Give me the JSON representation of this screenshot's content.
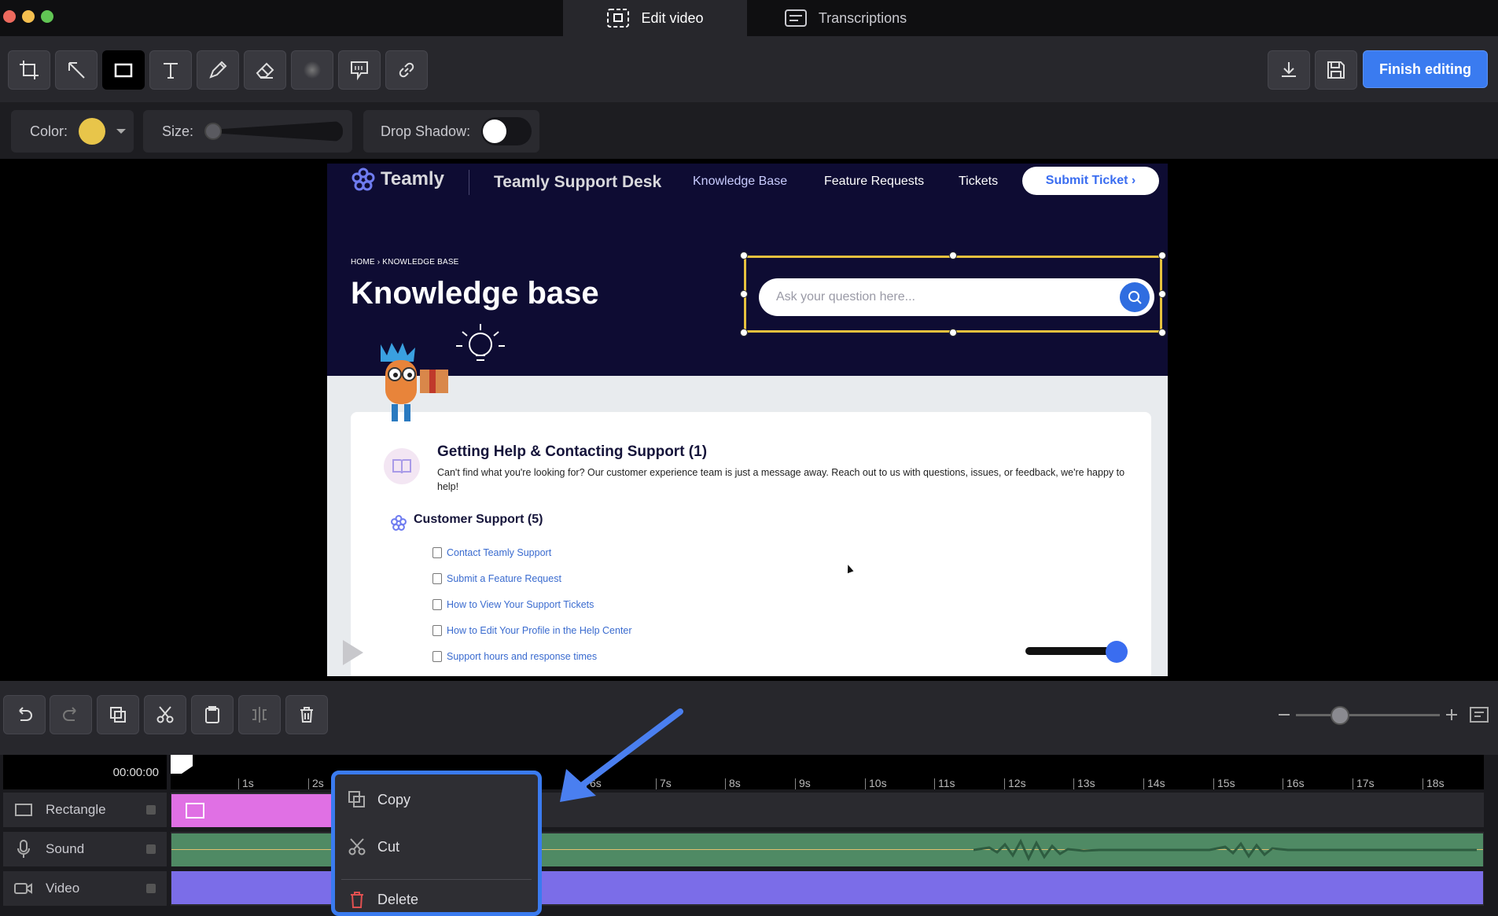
{
  "titlebar": {
    "tabs": [
      {
        "label": "Edit video",
        "active": true
      },
      {
        "label": "Transcriptions",
        "active": false
      }
    ]
  },
  "toolbar": {
    "tools": [
      "crop-icon",
      "arrow-icon",
      "rectangle-icon",
      "text-icon",
      "pencil-icon",
      "eraser-icon",
      "blur-icon",
      "callout-icon",
      "link-icon"
    ],
    "selected_tool": "rectangle-icon",
    "finish_label": "Finish editing"
  },
  "options": {
    "color_label": "Color:",
    "color_value": "#e8c54a",
    "size_label": "Size:",
    "size_level": 0,
    "shadow_label": "Drop Shadow:",
    "shadow_on": false
  },
  "canvas": {
    "brand": "Teamly",
    "desk_title": "Teamly Support Desk",
    "nav": [
      "Knowledge Base",
      "Feature Requests",
      "Tickets"
    ],
    "submit_ticket": "Submit Ticket ›",
    "breadcrumb": "HOME  ›  KNOWLEDGE BASE",
    "page_title": "Knowledge base",
    "search_placeholder": "Ask your question here...",
    "section_title": "Getting Help & Contacting Support (1)",
    "section_desc": "Can't find what you're looking for? Our customer experience team is just a message away. Reach out to us with questions, issues, or feedback, we're happy to help!",
    "subsection_title": "Customer Support (5)",
    "articles": [
      "Contact Teamly Support",
      "Submit a Feature Request",
      "How to View Your Support Tickets",
      "How to Edit Your Profile in the Help Center",
      "Support hours and response times"
    ]
  },
  "timeline": {
    "timecode": "00:00:00",
    "ticks": [
      "1s",
      "2s",
      "6s",
      "7s",
      "8s",
      "9s",
      "10s",
      "11s",
      "12s",
      "13s",
      "14s",
      "15s",
      "16s",
      "17s",
      "18s"
    ],
    "tracks": [
      "Rectangle",
      "Sound",
      "Video"
    ],
    "zoom_level": 0.3
  },
  "context_menu": {
    "items": [
      "Copy",
      "Cut",
      "Delete"
    ]
  },
  "colors": {
    "accent": "#3a7bf0",
    "rect_clip": "#e070e4",
    "sound_clip": "#4f8a64",
    "video_clip": "#7b6de8"
  }
}
